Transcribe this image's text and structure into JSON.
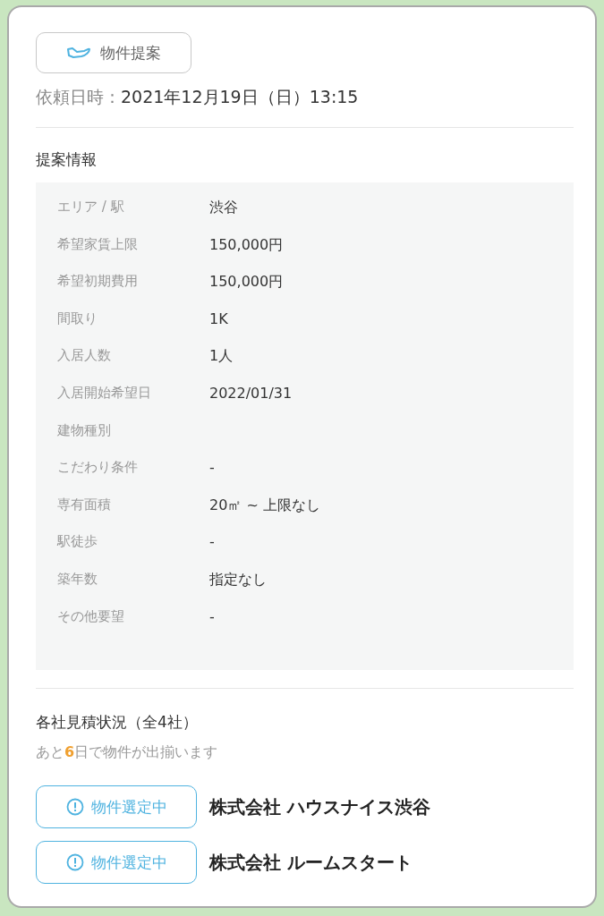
{
  "header_button": {
    "label": "物件提案"
  },
  "request": {
    "label": "依頼日時：",
    "value": "2021年12月19日（日）13:15"
  },
  "proposal": {
    "title": "提案情報",
    "rows": [
      {
        "label": "エリア / 駅",
        "value": "渋谷"
      },
      {
        "label": "希望家賃上限",
        "value": "150,000円"
      },
      {
        "label": "希望初期費用",
        "value": "150,000円"
      },
      {
        "label": "間取り",
        "value": "1K"
      },
      {
        "label": "入居人数",
        "value": "1人"
      },
      {
        "label": "入居開始希望日",
        "value": "2022/01/31"
      },
      {
        "label": "建物種別"
      },
      {
        "label": "こだわり条件",
        "value": "-"
      },
      {
        "label": "専有面積",
        "value": "20㎡ ~ 上限なし"
      },
      {
        "label": "駅徒歩",
        "value": "-"
      },
      {
        "label": "築年数",
        "value": "指定なし"
      },
      {
        "label": "その他要望",
        "value": "-"
      }
    ]
  },
  "estimates": {
    "title": "各社見積状況（全4社）",
    "notice": {
      "before": "あと",
      "count": "6",
      "after": "日で物件が出揃います"
    },
    "companies": [
      {
        "status": "物件選定中",
        "kind": "selecting",
        "name": "株式会社 ハウスナイス渋谷"
      },
      {
        "status": "物件選定中",
        "kind": "selecting",
        "name": "株式会社 ルームスタート"
      }
    ]
  }
}
